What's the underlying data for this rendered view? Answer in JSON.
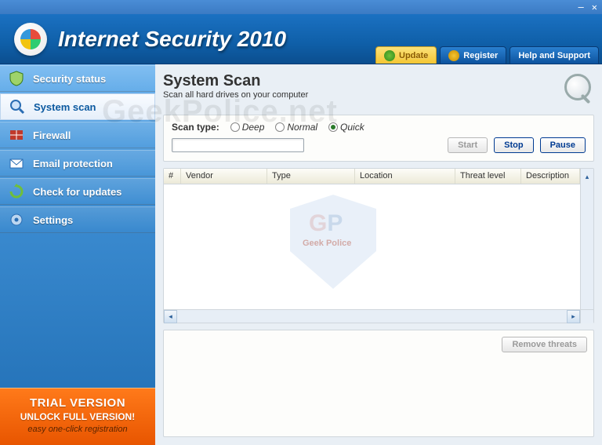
{
  "titlebar": {
    "minimize": "—",
    "close": "✕"
  },
  "header": {
    "title": "Internet Security 2010",
    "buttons": {
      "update": "Update",
      "register": "Register",
      "help": "Help and Support"
    }
  },
  "sidebar": {
    "items": [
      {
        "label": "Security status"
      },
      {
        "label": "System scan"
      },
      {
        "label": "Firewall"
      },
      {
        "label": "Email protection"
      },
      {
        "label": "Check for updates"
      },
      {
        "label": "Settings"
      }
    ]
  },
  "trial": {
    "line1": "TRIAL VERSION",
    "line2": "UNLOCK FULL VERSION!",
    "line3": "easy one-click registration"
  },
  "main": {
    "title": "System Scan",
    "subtitle": "Scan all hard drives on your computer",
    "scan_type_label": "Scan type:",
    "scan_modes": {
      "deep": "Deep",
      "normal": "Normal",
      "quick": "Quick"
    },
    "selected_mode": "quick",
    "buttons": {
      "start": "Start",
      "stop": "Stop",
      "pause": "Pause",
      "remove": "Remove threats"
    },
    "columns": [
      "#",
      "Vendor",
      "Type",
      "Location",
      "Threat level",
      "Description"
    ]
  },
  "watermark": {
    "text": "GeekPolice.net",
    "badge_initials": "GP",
    "badge_sub": "Geek Police"
  }
}
